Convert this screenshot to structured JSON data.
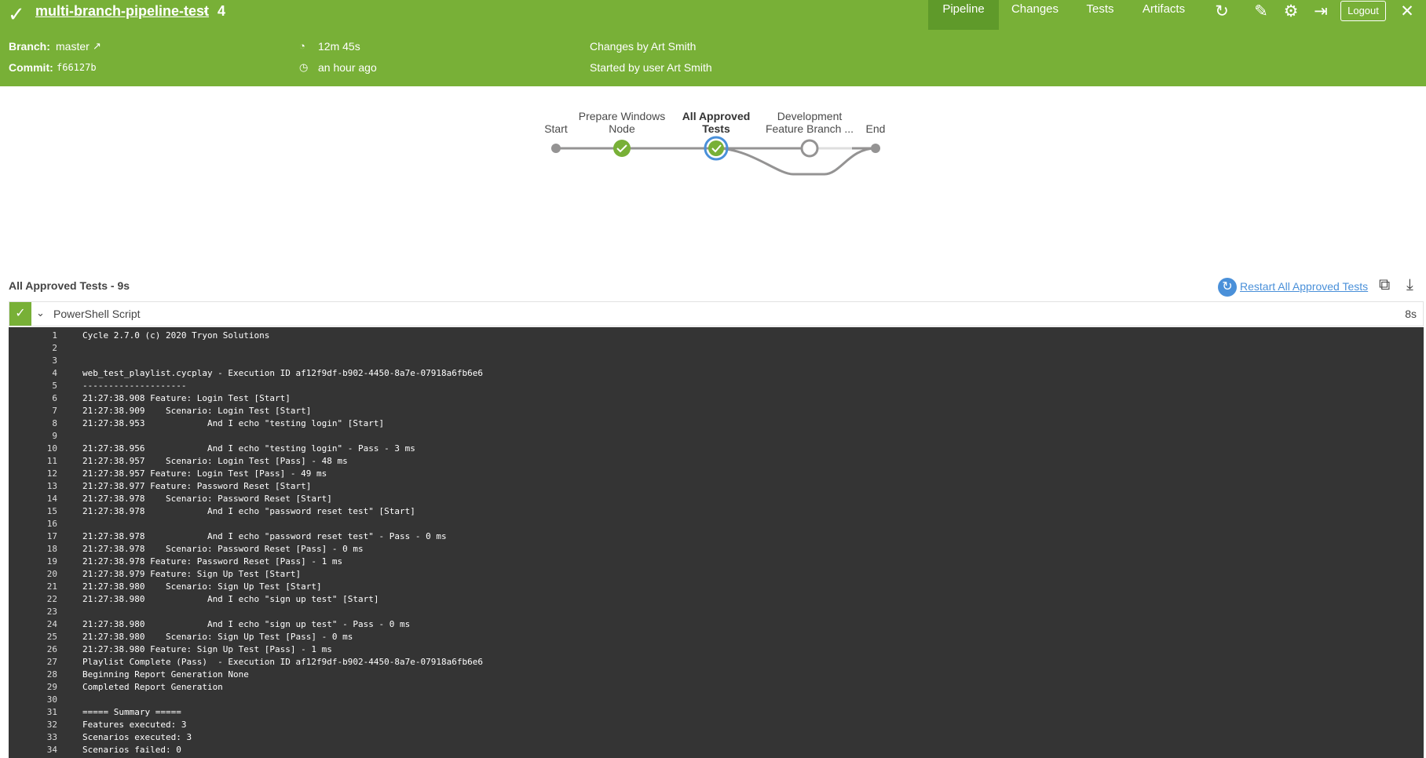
{
  "header": {
    "title": "multi-branch-pipeline-test",
    "run_number": "4",
    "tabs": [
      "Pipeline",
      "Changes",
      "Tests",
      "Artifacts"
    ],
    "active_tab": "Pipeline",
    "logout_label": "Logout",
    "colors": {
      "bar": "#78b037",
      "active_tab": "#5f9a2a"
    }
  },
  "info": {
    "branch_label": "Branch:",
    "branch_value": "master",
    "commit_label": "Commit:",
    "commit_value": "f66127b",
    "duration": "12m 45s",
    "started": "an hour ago",
    "changes": "Changes by Art Smith",
    "started_by": "Started by user Art Smith"
  },
  "pipeline": {
    "stages": [
      {
        "label": "Start",
        "status": "start"
      },
      {
        "label": "Prepare Windows Node",
        "status": "success"
      },
      {
        "label": "All Approved Tests",
        "status": "success-selected"
      },
      {
        "label": "Development Feature Branch ...",
        "status": "not-built"
      },
      {
        "label": "End",
        "status": "end"
      }
    ]
  },
  "section": {
    "title": "All Approved Tests - 9s",
    "restart_label": "Restart All Approved Tests"
  },
  "step": {
    "name": "PowerShell Script",
    "duration": "8s"
  },
  "log": {
    "lines": [
      {
        "n": "1",
        "t": "Cycle 2.7.0 (c) 2020 Tryon Solutions"
      },
      {
        "n": "2",
        "t": ""
      },
      {
        "n": "3",
        "t": ""
      },
      {
        "n": "4",
        "t": "web_test_playlist.cycplay - Execution ID af12f9df-b902-4450-8a7e-07918a6fb6e6"
      },
      {
        "n": "5",
        "t": "--------------------"
      },
      {
        "n": "6",
        "t": "21:27:38.908 Feature: Login Test [Start]"
      },
      {
        "n": "7",
        "t": "21:27:38.909    Scenario: Login Test [Start]"
      },
      {
        "n": "8",
        "t": "21:27:38.953            And I echo \"testing login\" [Start]"
      },
      {
        "n": "9",
        "t": ""
      },
      {
        "n": "10",
        "t": "21:27:38.956            And I echo \"testing login\" - Pass - 3 ms"
      },
      {
        "n": "11",
        "t": "21:27:38.957    Scenario: Login Test [Pass] - 48 ms"
      },
      {
        "n": "12",
        "t": "21:27:38.957 Feature: Login Test [Pass] - 49 ms"
      },
      {
        "n": "13",
        "t": "21:27:38.977 Feature: Password Reset [Start]"
      },
      {
        "n": "14",
        "t": "21:27:38.978    Scenario: Password Reset [Start]"
      },
      {
        "n": "15",
        "t": "21:27:38.978            And I echo \"password reset test\" [Start]"
      },
      {
        "n": "16",
        "t": ""
      },
      {
        "n": "17",
        "t": "21:27:38.978            And I echo \"password reset test\" - Pass - 0 ms"
      },
      {
        "n": "18",
        "t": "21:27:38.978    Scenario: Password Reset [Pass] - 0 ms"
      },
      {
        "n": "19",
        "t": "21:27:38.978 Feature: Password Reset [Pass] - 1 ms"
      },
      {
        "n": "20",
        "t": "21:27:38.979 Feature: Sign Up Test [Start]"
      },
      {
        "n": "21",
        "t": "21:27:38.980    Scenario: Sign Up Test [Start]"
      },
      {
        "n": "22",
        "t": "21:27:38.980            And I echo \"sign up test\" [Start]"
      },
      {
        "n": "23",
        "t": ""
      },
      {
        "n": "24",
        "t": "21:27:38.980            And I echo \"sign up test\" - Pass - 0 ms"
      },
      {
        "n": "25",
        "t": "21:27:38.980    Scenario: Sign Up Test [Pass] - 0 ms"
      },
      {
        "n": "26",
        "t": "21:27:38.980 Feature: Sign Up Test [Pass] - 1 ms"
      },
      {
        "n": "27",
        "t": "Playlist Complete (Pass)  - Execution ID af12f9df-b902-4450-8a7e-07918a6fb6e6"
      },
      {
        "n": "28",
        "t": "Beginning Report Generation None"
      },
      {
        "n": "29",
        "t": "Completed Report Generation"
      },
      {
        "n": "30",
        "t": ""
      },
      {
        "n": "31",
        "t": "===== Summary ====="
      },
      {
        "n": "32",
        "t": "Features executed: 3"
      },
      {
        "n": "33",
        "t": "Scenarios executed: 3"
      },
      {
        "n": "34",
        "t": "Scenarios failed: 0"
      }
    ]
  }
}
